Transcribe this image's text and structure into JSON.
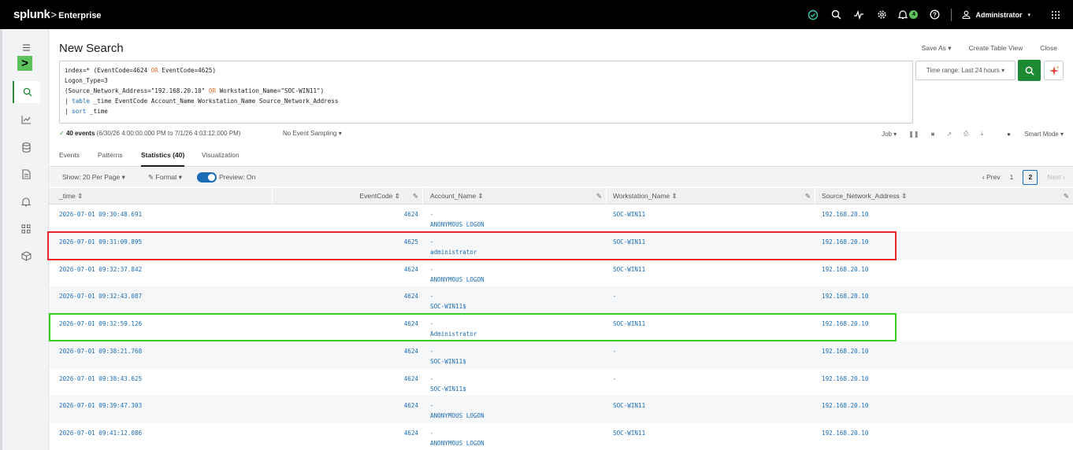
{
  "brand": {
    "name": "splunk",
    "separator": ">",
    "product": "Enterprise"
  },
  "topbar": {
    "user_name": "Administrator",
    "notification_count": "4",
    "icons": [
      "health-check-icon",
      "search-icon",
      "activity-icon",
      "settings-gear-icon",
      "bell-icon",
      "help-icon",
      "user-icon",
      "apps-grid-icon"
    ]
  },
  "leftnav": {
    "items": [
      "menu-icon",
      "app-logo",
      "search-icon",
      "dashboards-chart-icon",
      "datasets-icon",
      "reports-icon",
      "alerts-bell-icon",
      "apps-icon",
      "packages-icon"
    ],
    "logo_glyph": ">"
  },
  "page": {
    "title": "New Search",
    "save_as": "Save As ▾",
    "create_table_view": "Create Table View",
    "close": "Close"
  },
  "query": {
    "line1_a": "index=* (EventCode=4624 ",
    "line1_or": "OR",
    "line1_b": " EventCode=4625)",
    "line2": "Logon_Type=3",
    "line3_a": "(Source_Network_Address=\"192.168.20.10\" ",
    "line3_or": "OR",
    "line3_b": " Workstation_Name=\"SOC-WIN11\")",
    "line4_pipe": "| ",
    "line4_cmd": "table",
    "line4_rest": " _time EventCode Account_Name Workstation_Name Source_Network_Address",
    "line5_pipe": "| ",
    "line5_cmd": "sort",
    "line5_rest": " _time"
  },
  "time_range": "Time range: Last 24 hours ▾",
  "status": {
    "check": "✓",
    "events": "40 events",
    "range": "(6/30/26 4:00:00.000 PM to 7/1/26 4:03:12.000 PM)",
    "sampling": "No Event Sampling ▾",
    "job": "Job ▾",
    "mode": "Smart Mode ▾"
  },
  "tabs": [
    "Events",
    "Patterns",
    "Statistics (40)",
    "Visualization"
  ],
  "active_tab": "Statistics (40)",
  "toolbar": {
    "per_page": "Show: 20 Per Page ▾",
    "format": "Format ▾",
    "preview": "Preview: On",
    "prev": "‹ Prev",
    "page1": "1",
    "page2": "2",
    "next": "Next ›"
  },
  "columns": {
    "time": "_time ⇕",
    "code": "EventCode ⇕",
    "acct": "Account_Name ⇕",
    "ws": "Workstation_Name ⇕",
    "src": "Source_Network_Address ⇕"
  },
  "rows": [
    {
      "time": "2026-07-01 09:30:48.691",
      "code": "4624",
      "acct1": "-",
      "acct2": "ANONYMOUS LOGON",
      "ws": "SOC-WIN11",
      "src": "192.168.20.10"
    },
    {
      "time": "2026-07-01 09:31:09.895",
      "code": "4625",
      "acct1": "-",
      "acct2": "administrator",
      "ws": "SOC-WIN11",
      "src": "192.168.20.10"
    },
    {
      "time": "2026-07-01 09:32:37.842",
      "code": "4624",
      "acct1": "-",
      "acct2": "ANONYMOUS LOGON",
      "ws": "SOC-WIN11",
      "src": "192.168.20.10"
    },
    {
      "time": "2026-07-01 09:32:43.087",
      "code": "4624",
      "acct1": "-",
      "acct2": "SOC-WIN11$",
      "ws": "-",
      "src": "192.168.20.10"
    },
    {
      "time": "2026-07-01 09:32:59.126",
      "code": "4624",
      "acct1": "-",
      "acct2": "Administrator",
      "ws": "SOC-WIN11",
      "src": "192.168.20.10"
    },
    {
      "time": "2026-07-01 09:38:21.768",
      "code": "4624",
      "acct1": "-",
      "acct2": "SOC-WIN11$",
      "ws": "-",
      "src": "192.168.20.10"
    },
    {
      "time": "2026-07-01 09:38:43.625",
      "code": "4624",
      "acct1": "-",
      "acct2": "SOC-WIN11$",
      "ws": "-",
      "src": "192.168.20.10"
    },
    {
      "time": "2026-07-01 09:39:47.303",
      "code": "4624",
      "acct1": "-",
      "acct2": "ANONYMOUS LOGON",
      "ws": "SOC-WIN11",
      "src": "192.168.20.10"
    },
    {
      "time": "2026-07-01 09:41:12.086",
      "code": "4624",
      "acct1": "-",
      "acct2": "ANONYMOUS LOGON",
      "ws": "SOC-WIN11",
      "src": "192.168.20.10"
    }
  ],
  "highlights": {
    "red_row": 1,
    "green_row": 4
  },
  "colors": {
    "accent_green": "#1c8a33",
    "link_blue": "#1a6cb5",
    "highlight_red": "#e8272a",
    "highlight_green": "#33d11f"
  }
}
